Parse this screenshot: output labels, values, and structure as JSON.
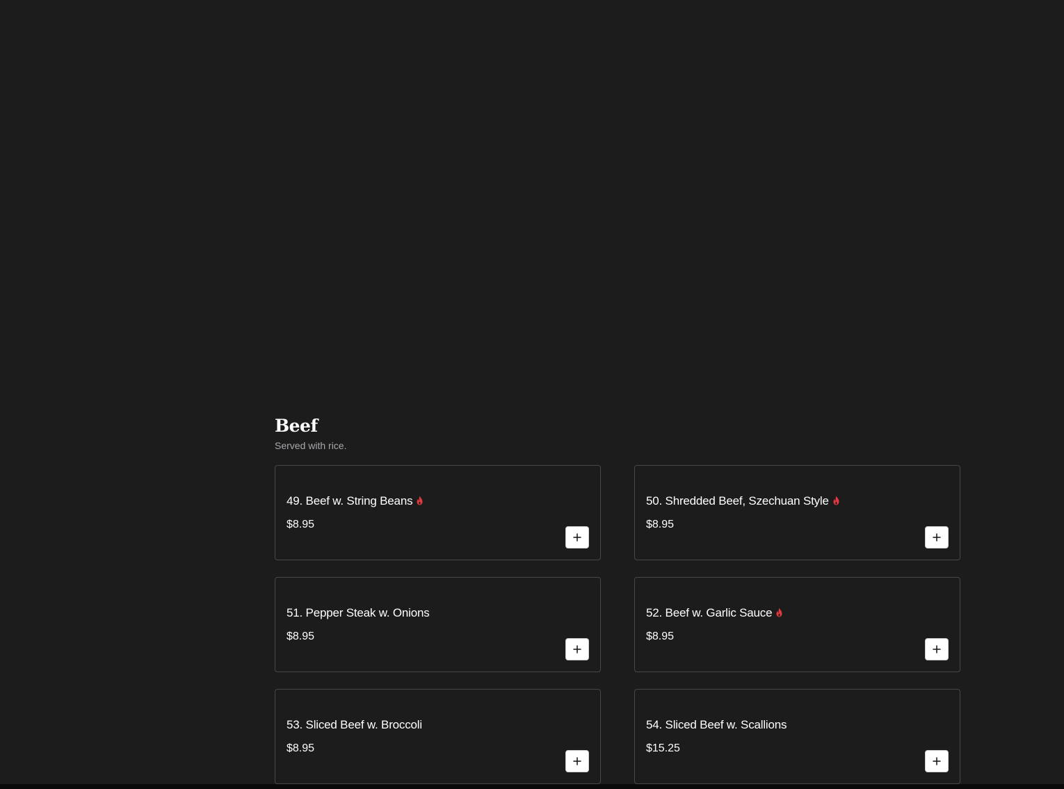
{
  "category": {
    "title": "Beef",
    "subtitle": "Served with rice."
  },
  "items": [
    {
      "name": "49. Beef w. String Beans",
      "price": "$8.95",
      "spicy": true
    },
    {
      "name": "50. Shredded Beef, Szechuan Style",
      "price": "$8.95",
      "spicy": true
    },
    {
      "name": "51. Pepper Steak w. Onions",
      "price": "$8.95",
      "spicy": false
    },
    {
      "name": "52. Beef w. Garlic Sauce",
      "price": "$8.95",
      "spicy": true
    },
    {
      "name": "53. Sliced Beef w. Broccoli",
      "price": "$8.95",
      "spicy": false
    },
    {
      "name": "54. Sliced Beef w. Scallions",
      "price": "$15.25",
      "spicy": false
    }
  ],
  "icons": {
    "spicy": "flame-icon",
    "add": "plus-icon"
  },
  "colors": {
    "background": "#1c1c1d",
    "card_border": "#48484b",
    "spicy": "#e0393e",
    "subtitle": "#a9a9ad",
    "add_button_bg": "#ffffff"
  }
}
